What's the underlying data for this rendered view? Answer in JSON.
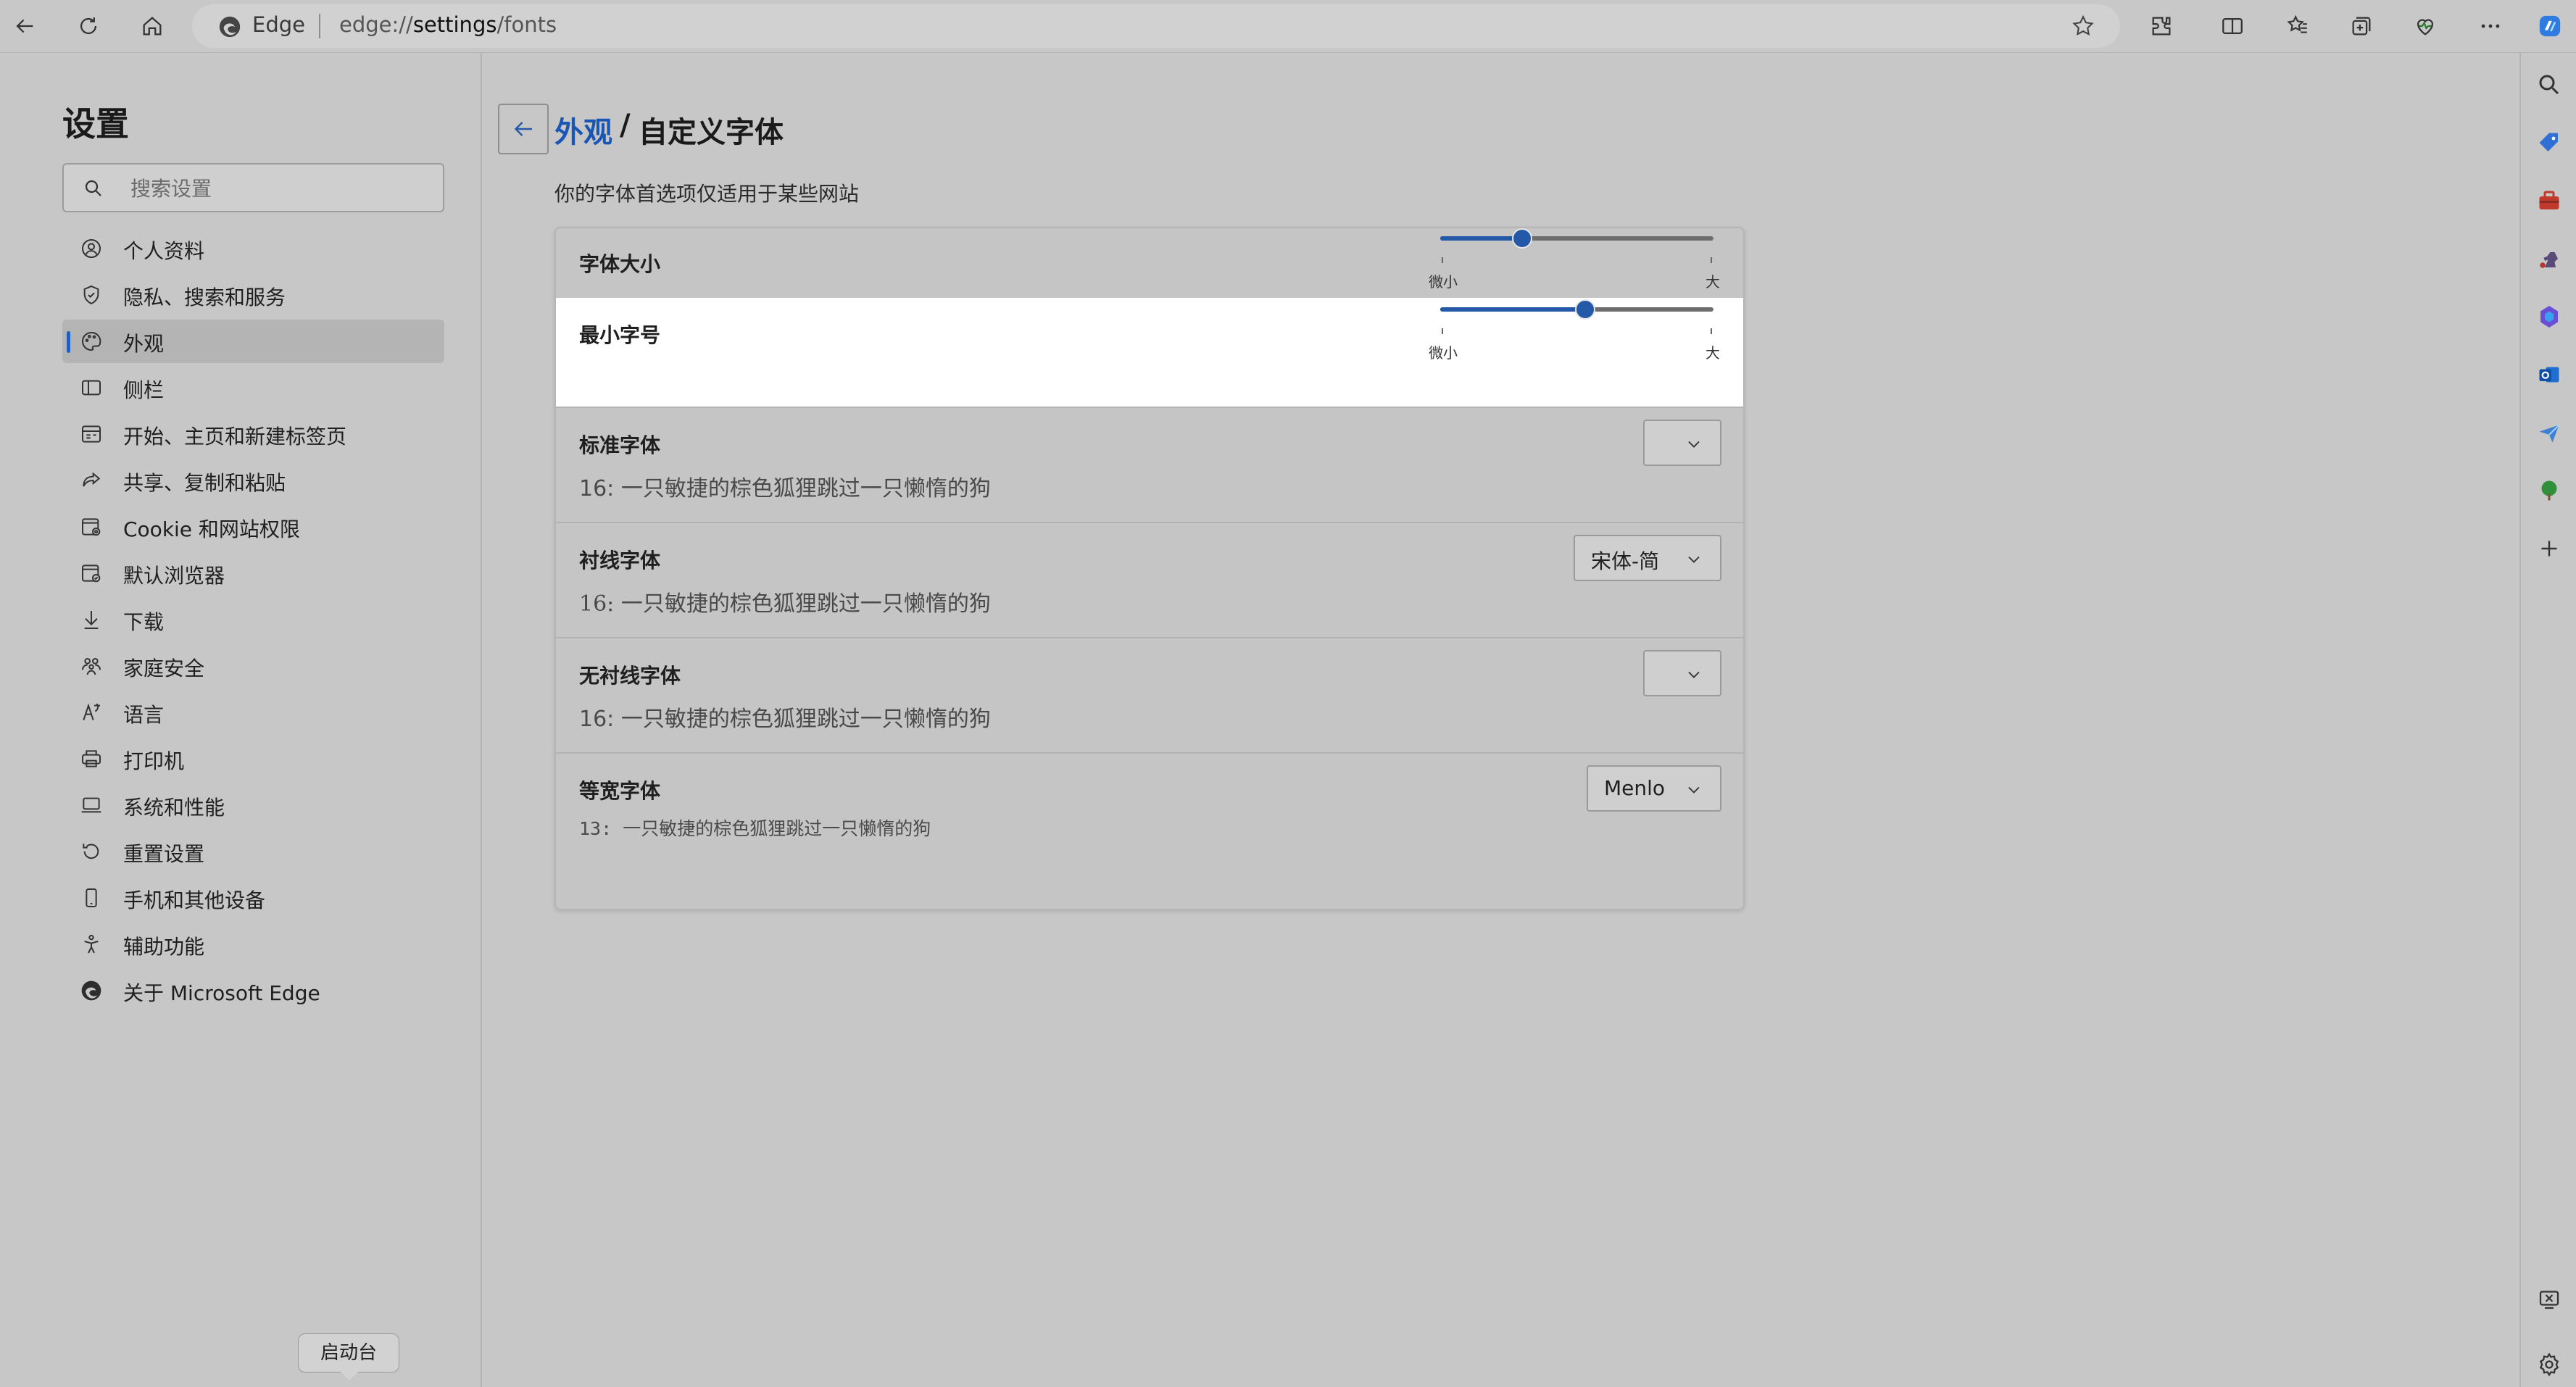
{
  "toolbar": {
    "edge_label": "Edge",
    "url_prefix": "edge://",
    "url_bold": "settings",
    "url_suffix": "/fonts",
    "icons": [
      "back-icon",
      "refresh-icon",
      "home-icon",
      "favorite-star-icon",
      "extensions-icon",
      "split-screen-icon",
      "favorites-icon",
      "collections-icon",
      "performance-icon",
      "more-icon",
      "copilot-icon"
    ]
  },
  "sidebar": {
    "title": "设置",
    "search_placeholder": "搜索设置",
    "items": [
      {
        "label": "个人资料",
        "icon": "profile-icon"
      },
      {
        "label": "隐私、搜索和服务",
        "icon": "privacy-icon"
      },
      {
        "label": "外观",
        "icon": "appearance-icon",
        "active": true
      },
      {
        "label": "侧栏",
        "icon": "sidebar-icon"
      },
      {
        "label": "开始、主页和新建标签页",
        "icon": "start-page-icon"
      },
      {
        "label": "共享、复制和粘贴",
        "icon": "share-icon"
      },
      {
        "label": "Cookie 和网站权限",
        "icon": "cookie-icon"
      },
      {
        "label": "默认浏览器",
        "icon": "default-browser-icon"
      },
      {
        "label": "下载",
        "icon": "download-icon"
      },
      {
        "label": "家庭安全",
        "icon": "family-icon"
      },
      {
        "label": "语言",
        "icon": "language-icon"
      },
      {
        "label": "打印机",
        "icon": "printer-icon"
      },
      {
        "label": "系统和性能",
        "icon": "system-icon"
      },
      {
        "label": "重置设置",
        "icon": "reset-icon"
      },
      {
        "label": "手机和其他设备",
        "icon": "phone-icon"
      },
      {
        "label": "辅助功能",
        "icon": "accessibility-icon"
      },
      {
        "label": "关于 Microsoft Edge",
        "icon": "edge-logo-icon"
      }
    ]
  },
  "launchpad_tooltip": "启动台",
  "main": {
    "breadcrumb_parent": "外观",
    "breadcrumb_sep": "/",
    "breadcrumb_current": "自定义字体",
    "subtitle": "你的字体首选项仅适用于某些网站",
    "font_size": {
      "title": "字体大小",
      "min_label": "微小",
      "max_label": "大",
      "value": 0.3
    },
    "min_font_size": {
      "title": "最小字号",
      "min_label": "微小",
      "max_label": "大",
      "value": 0.53
    },
    "standard_font": {
      "title": "标准字体",
      "sample": "16: 一只敏捷的棕色狐狸跳过一只懒惰的狗",
      "value": ""
    },
    "serif_font": {
      "title": "衬线字体",
      "sample": "16: 一只敏捷的棕色狐狸跳过一只懒惰的狗",
      "value": "宋体-简"
    },
    "sans_serif_font": {
      "title": "无衬线字体",
      "sample": "16: 一只敏捷的棕色狐狸跳过一只懒惰的狗",
      "value": ""
    },
    "monospace_font": {
      "title": "等宽字体",
      "sample": "13: 一只敏捷的棕色狐狸跳过一只懒惰的狗",
      "value": "Menlo"
    }
  },
  "right_sidebar": {
    "icons": [
      "search-icon",
      "shopping-tag-icon",
      "tools-icon",
      "games-icon",
      "m365-icon",
      "outlook-icon",
      "send-icon",
      "tree-icon",
      "add-icon",
      "screenshot-icon",
      "settings-icon"
    ]
  },
  "colors": {
    "accent": "#2459a8",
    "link": "#1a56b3",
    "background": "#c7c7c7",
    "selected_row": "#ffffff"
  }
}
